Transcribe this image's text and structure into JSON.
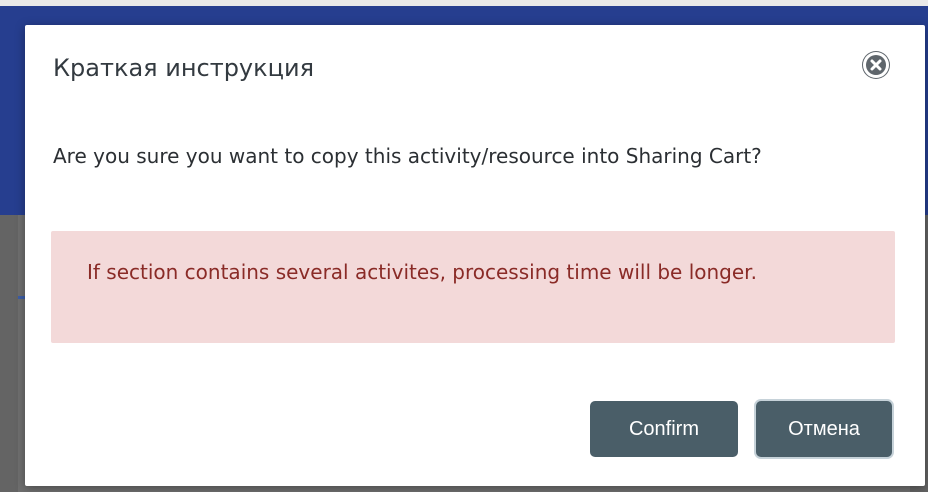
{
  "modal": {
    "title": "Краткая инструкция",
    "message": "Are you sure you want to copy this activity/resource into Sharing Cart?",
    "alert": "If section contains several activites, processing time will be longer.",
    "buttons": {
      "confirm": "Confirm",
      "cancel": "Отмена"
    },
    "close_icon": "close-circle-icon"
  },
  "colors": {
    "header_bg": "#263e8f",
    "overlay_gray": "#6f6f6f",
    "alert_bg": "#f3d9d9",
    "alert_text": "#8a2b27",
    "button_bg": "#4a5e68"
  }
}
